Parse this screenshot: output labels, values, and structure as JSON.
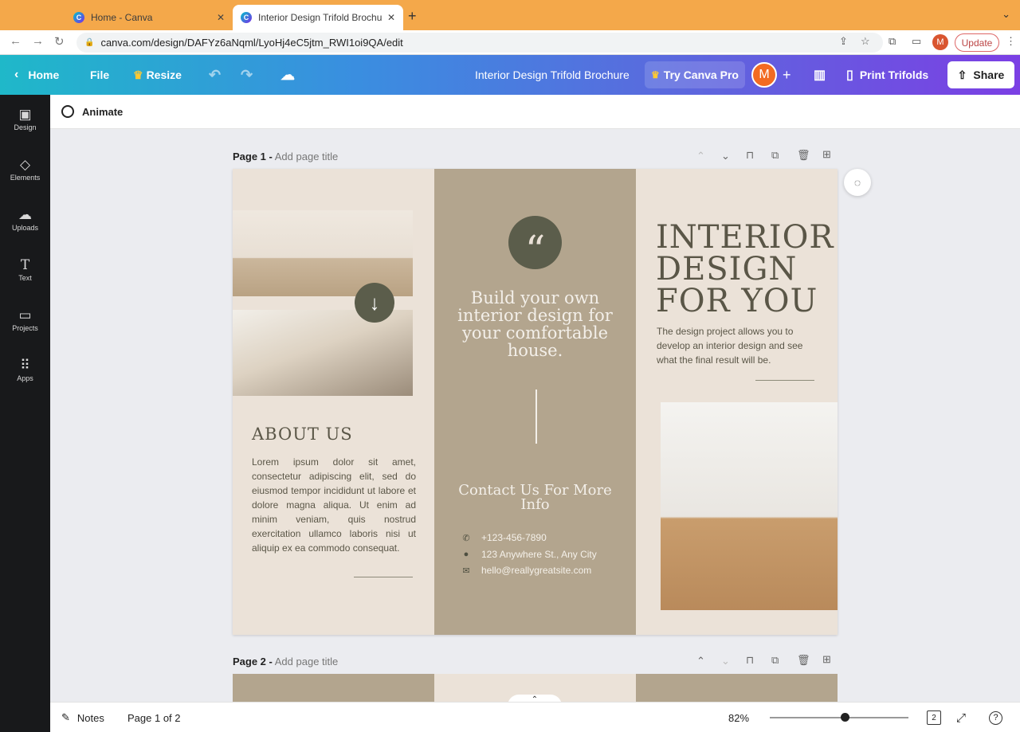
{
  "browser": {
    "tabs": [
      {
        "title": "Home - Canva",
        "close": "✕"
      },
      {
        "title": "Interior Design Trifold Brochure",
        "close": "✕"
      }
    ],
    "new_tab": "+",
    "url": "canva.com/design/DAFYz6aNqml/LyoHj4eC5jtm_RWI1oi9QA/edit",
    "profile_initial": "M",
    "update_label": "Update"
  },
  "header": {
    "home_label": "Home",
    "file_label": "File",
    "resize_label": "Resize",
    "doc_title": "Interior Design Trifold Brochure",
    "try_pro_label": "Try Canva Pro",
    "avatar_initial": "M",
    "print_label": "Print Trifolds",
    "share_label": "Share"
  },
  "rail": {
    "items": [
      {
        "label": "Design"
      },
      {
        "label": "Elements"
      },
      {
        "label": "Uploads"
      },
      {
        "label": "Text"
      },
      {
        "label": "Projects"
      },
      {
        "label": "Apps"
      }
    ]
  },
  "toolbar": {
    "animate_label": "Animate"
  },
  "pages": [
    {
      "label": "Page 1 -",
      "title_placeholder": "Add page title"
    },
    {
      "label": "Page 2 -",
      "title_placeholder": "Add page title"
    }
  ],
  "brochure": {
    "about_title": "ABOUT US",
    "about_body": "Lorem ipsum dolor sit amet, consectetur adipiscing elit, sed do eiusmod tempor incididunt ut labore et dolore magna aliqua. Ut enim ad minim veniam, quis nostrud exercitation ullamco laboris nisi ut aliquip ex ea commodo consequat.",
    "quote_mark": "“",
    "mid_heading": "Build your own interior design for your comfortable house.",
    "contact_heading": "Contact Us For More Info",
    "phone": "+123-456-7890",
    "address": "123 Anywhere St., Any City",
    "email": "hello@reallygreatsite.com",
    "right_title": "INTERIOR DESIGN FOR YOU",
    "right_body": "The design project allows you to develop an interior design and see what the final result will be."
  },
  "bottombar": {
    "notes_label": "Notes",
    "page_indicator": "Page 1 of 2",
    "zoom": "82%",
    "zoom_level": 0.82,
    "page_count": "2"
  },
  "colors": {
    "brochure_light": "#ebe2d8",
    "brochure_tan": "#b3a58e",
    "brochure_olive": "#5b5d4b",
    "tabbar": "#f4a84a"
  }
}
